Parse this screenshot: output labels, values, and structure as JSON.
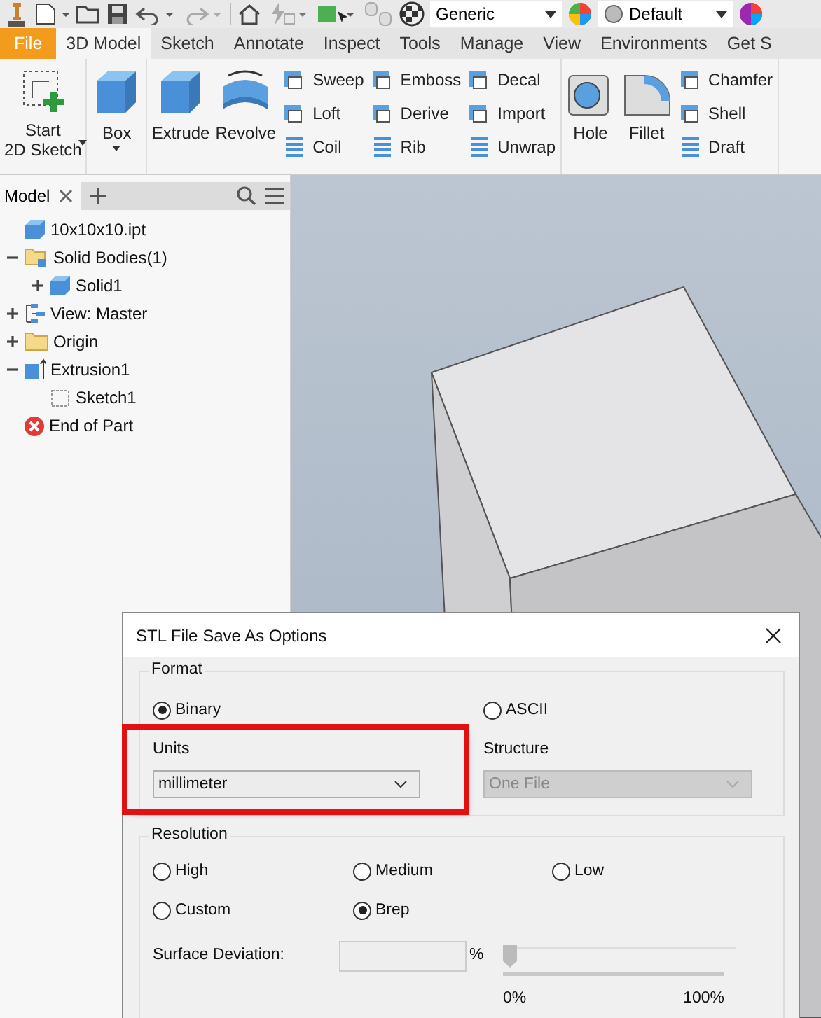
{
  "quick_access": {
    "material": "Generic",
    "appearance": "Default"
  },
  "ribbon_tabs": [
    {
      "label": "File",
      "kind": "file",
      "selected": false
    },
    {
      "label": "3D Model",
      "kind": "tab",
      "selected": true
    },
    {
      "label": "Sketch",
      "kind": "tab",
      "selected": false
    },
    {
      "label": "Annotate",
      "kind": "tab",
      "selected": false
    },
    {
      "label": "Inspect",
      "kind": "tab",
      "selected": false
    },
    {
      "label": "Tools",
      "kind": "tab",
      "selected": false
    },
    {
      "label": "Manage",
      "kind": "tab",
      "selected": false
    },
    {
      "label": "View",
      "kind": "tab",
      "selected": false
    },
    {
      "label": "Environments",
      "kind": "tab",
      "selected": false
    },
    {
      "label": "Get S",
      "kind": "tab",
      "selected": false
    }
  ],
  "ribbon_groups": [
    {
      "large": [
        {
          "label": "Start\n2D Sketch",
          "dropdown": true
        }
      ]
    },
    {
      "large": [
        {
          "label": "Box",
          "dropdown": true
        }
      ]
    },
    {
      "large": [
        {
          "label": "Extrude",
          "dropdown": false
        },
        {
          "label": "Revolve",
          "dropdown": false
        }
      ],
      "small": [
        [
          "Sweep",
          "Loft",
          "Coil"
        ],
        [
          "Emboss",
          "Derive",
          "Rib"
        ],
        [
          "Decal",
          "Import",
          "Unwrap"
        ]
      ]
    },
    {
      "large": [
        {
          "label": "Hole",
          "dropdown": false
        },
        {
          "label": "Fillet",
          "dropdown": false
        }
      ],
      "small": [
        [
          "Chamfer",
          "Shell",
          "Draft"
        ]
      ]
    }
  ],
  "browser": {
    "tab": "Model",
    "tree": [
      {
        "label": "10x10x10.ipt",
        "kind": "part"
      },
      {
        "label": "Solid Bodies(1)",
        "kind": "bodies",
        "expanded": true,
        "children": [
          {
            "label": "Solid1",
            "kind": "body",
            "expanded": false
          }
        ]
      },
      {
        "label": "View: Master",
        "kind": "view",
        "expanded": false
      },
      {
        "label": "Origin",
        "kind": "folder",
        "expanded": false
      },
      {
        "label": "Extrusion1",
        "kind": "feature",
        "expanded": true,
        "children": [
          {
            "label": "Sketch1",
            "kind": "sketch"
          }
        ]
      },
      {
        "label": "End of Part",
        "kind": "end"
      }
    ]
  },
  "dialog": {
    "title": "STL File Save As Options",
    "format": {
      "legend": "Format",
      "options": [
        {
          "label": "Binary",
          "selected": true
        },
        {
          "label": "ASCII",
          "selected": false
        }
      ],
      "units": {
        "label": "Units",
        "value": "millimeter",
        "highlighted": true
      },
      "structure": {
        "label": "Structure",
        "value": "One File",
        "disabled": true
      }
    },
    "resolution": {
      "legend": "Resolution",
      "options": [
        {
          "label": "High",
          "selected": false
        },
        {
          "label": "Medium",
          "selected": false
        },
        {
          "label": "Low",
          "selected": false
        },
        {
          "label": "Custom",
          "selected": false
        },
        {
          "label": "Brep",
          "selected": true
        }
      ],
      "surface_deviation": {
        "label": "Surface Deviation:",
        "unit": "%",
        "level": 0,
        "min_label": "0%",
        "max_label": "100%"
      }
    }
  }
}
